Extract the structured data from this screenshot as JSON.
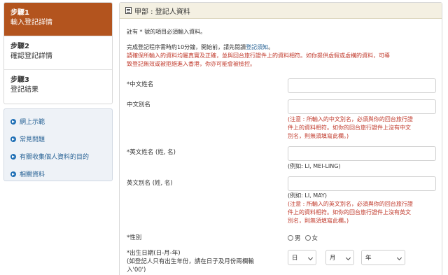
{
  "steps": [
    {
      "title": "步驟1",
      "desc": "輸入登記詳情",
      "active": true
    },
    {
      "title": "步驟2",
      "desc": "確認登記詳情",
      "active": false
    },
    {
      "title": "步驟3",
      "desc": "登記結果",
      "active": false
    }
  ],
  "links": [
    "網上示範",
    "常見問題",
    "有關收集個人資料的目的",
    "相關資料"
  ],
  "panel": {
    "title": "甲部 : 登記人資料",
    "required_note": "註有 * 號的項目必須輸入資料。",
    "intro_prefix": "完成登記程序需時約10分鐘，開始前，請先閱讀",
    "intro_link": "登記須知",
    "intro_suffix": "。",
    "warning_lines": [
      "請確保所輸入的資料均屬真實及正確，並與回台旅行證件上的資料相符。如你提供虛假或虛構的資料，可導",
      "致登記無效或被拒絕進入香港，你亦可能會被檢控。"
    ]
  },
  "form": {
    "chinese_name_label": "*中文姓名",
    "chinese_alias_label": "中文別名",
    "chinese_alias_warning": [
      "(注意 : 所輸入的中文別名，必須與你的回台旅行證",
      "件上的資料相符。如你的回台旅行證件上沒有中文",
      "別名，則無須填寫此欄。)"
    ],
    "english_name_label": "*英文姓名 (姓, 名)",
    "english_name_hint": "(例如: LI, MEI-LING)",
    "english_alias_label": "英文別名 (姓, 名)",
    "english_alias_hint": "(例如: LI, MAY)",
    "english_alias_warning": [
      "(注意 : 所輸入的英文別名，必須與你的回台旅行證",
      "件上的資料相符。如你的回台旅行證件上沒有英文",
      "別名，則無須填寫此欄。)"
    ],
    "gender_label": "*性別",
    "gender_options": [
      "男",
      "女"
    ],
    "dob_label": "*出生日期(日-月-年)",
    "dob_note_lines": [
      "(如登記人只有出生年份，請在日子及月份兩欄輸",
      "入'00')"
    ],
    "dob_day": "日",
    "dob_month": "月",
    "dob_year": "年"
  }
}
